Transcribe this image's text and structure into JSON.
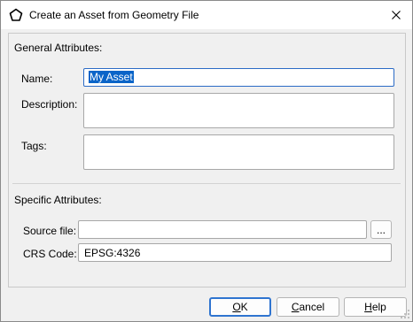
{
  "window": {
    "title": "Create an Asset from Geometry File",
    "icon": "pentagon-icon",
    "close_icon": "close-icon"
  },
  "general": {
    "heading": "General Attributes:",
    "name_label": "Name:",
    "name_value": "My Asset",
    "description_label": "Description:",
    "description_value": "",
    "tags_label": "Tags:",
    "tags_value": ""
  },
  "specific": {
    "heading": "Specific Attributes:",
    "source_label": "Source file:",
    "source_value": "",
    "browse_label": "...",
    "crs_label": "CRS Code:",
    "crs_value": "EPSG:4326"
  },
  "buttons": {
    "ok_mnemonic": "O",
    "ok_rest": "K",
    "cancel_mnemonic": "C",
    "cancel_rest": "ancel",
    "help_mnemonic": "H",
    "help_rest": "elp"
  },
  "colors": {
    "selection": "#0a64c8",
    "focus_border": "#2c6bc6",
    "dialog_bg": "#f0f0f0"
  }
}
